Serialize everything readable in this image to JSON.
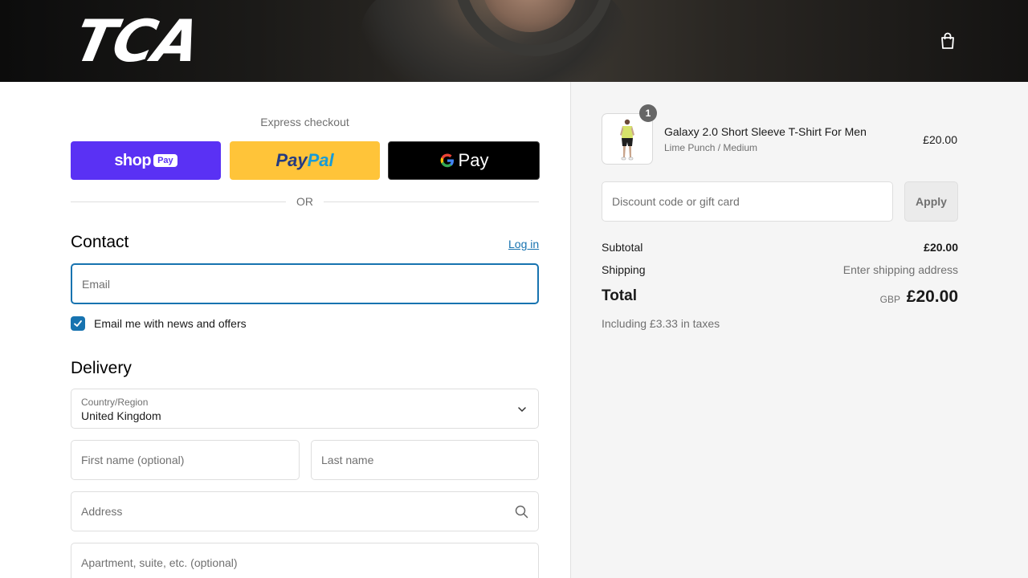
{
  "header": {
    "logo": "TCA",
    "cart_icon": "shopping-bag-icon"
  },
  "express": {
    "title": "Express checkout",
    "shop_pay": {
      "brand": "shop",
      "pay": "Pay",
      "color": "#5a31f4"
    },
    "paypal": {
      "part1": "Pay",
      "part2": "Pal",
      "color": "#ffc439"
    },
    "gpay": {
      "g": "G",
      "label": "Pay",
      "color": "#000000"
    },
    "separator": "OR"
  },
  "contact": {
    "heading": "Contact",
    "login_link": "Log in",
    "email_placeholder": "Email",
    "newsletter_label": "Email me with news and offers",
    "newsletter_checked": true
  },
  "delivery": {
    "heading": "Delivery",
    "country_label": "Country/Region",
    "country_value": "United Kingdom",
    "first_name_placeholder": "First name (optional)",
    "last_name_placeholder": "Last name",
    "address_placeholder": "Address",
    "apartment_placeholder": "Apartment, suite, etc. (optional)"
  },
  "summary": {
    "item": {
      "quantity": "1",
      "name": "Galaxy 2.0 Short Sleeve T-Shirt For Men",
      "variant": "Lime Punch / Medium",
      "price": "£20.00"
    },
    "discount_placeholder": "Discount code or gift card",
    "apply_label": "Apply",
    "subtotal_label": "Subtotal",
    "subtotal_value": "£20.00",
    "shipping_label": "Shipping",
    "shipping_value": "Enter shipping address",
    "total_label": "Total",
    "total_currency": "GBP",
    "total_value": "£20.00",
    "taxes_note": "Including £3.33 in taxes"
  },
  "colors": {
    "accent": "#1773b0",
    "summary_bg": "#f5f5f5"
  }
}
